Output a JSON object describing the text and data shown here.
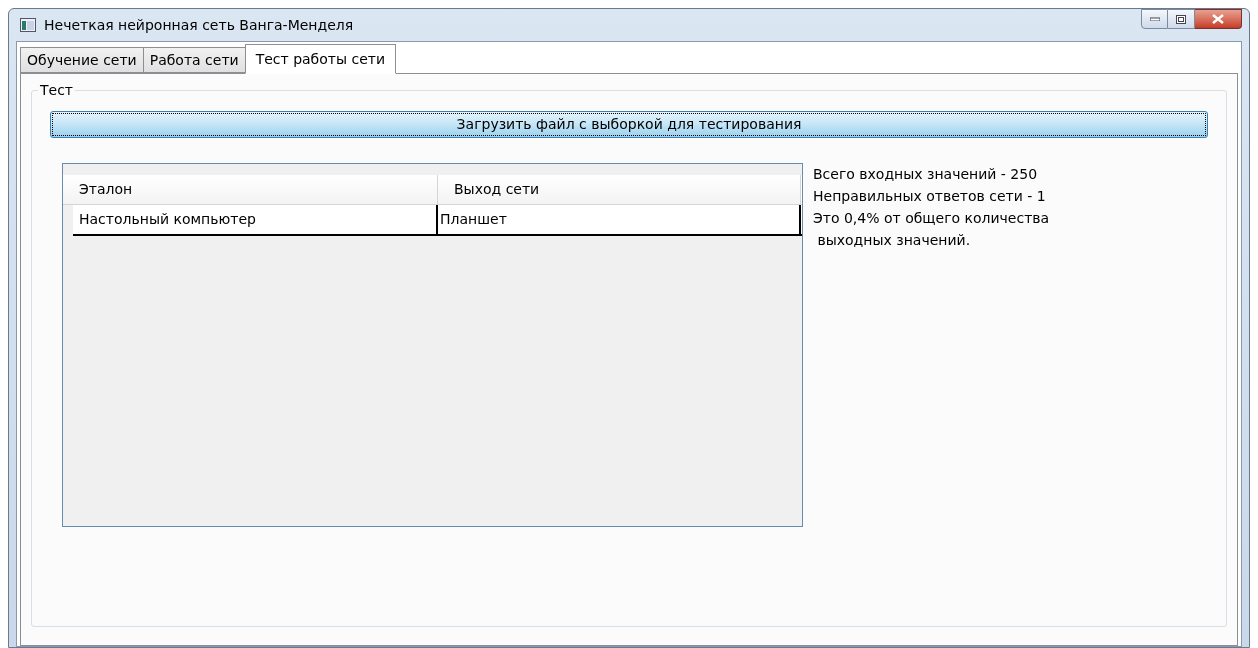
{
  "window": {
    "title": "Нечеткая нейронная сеть Ванга-Менделя"
  },
  "tabs": [
    {
      "label": "Обучение сети",
      "selected": false
    },
    {
      "label": "Работа сети",
      "selected": false
    },
    {
      "label": "Тест работы сети",
      "selected": true
    }
  ],
  "group": {
    "title": "Тест"
  },
  "load_button": "Загрузить файл с выборкой для тестирования",
  "table": {
    "columns": [
      "Эталон",
      "Выход сети"
    ],
    "rows": [
      [
        "Настольный компьютер",
        "Планшет"
      ]
    ]
  },
  "summary": [
    "Всего входных значений - 250",
    "Неправильных ответов сети - 1",
    "Это 0,4% от общего количества",
    " выходных значений."
  ]
}
